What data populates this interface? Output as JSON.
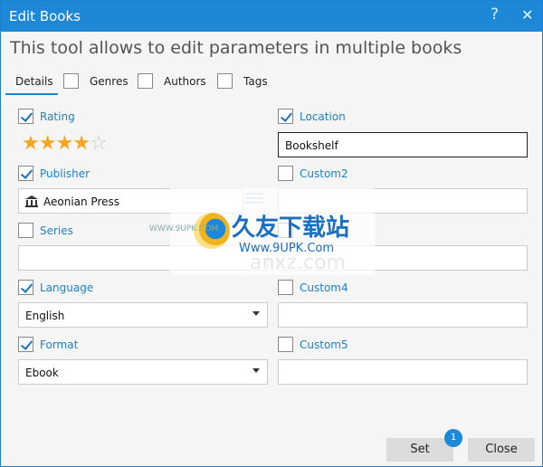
{
  "window": {
    "title": "Edit Books",
    "help_label": "?",
    "close_label": "✕"
  },
  "headline": "This tool allows to edit parameters in multiple books",
  "tabs": [
    {
      "label": "Details",
      "selected": true
    },
    {
      "label": "Genres"
    },
    {
      "label": "Authors"
    },
    {
      "label": "Tags"
    }
  ],
  "left": {
    "rating": {
      "label": "Rating",
      "checked": true,
      "stars_filled": 4,
      "stars_total": 5
    },
    "publisher": {
      "label": "Publisher",
      "checked": true,
      "value": "Aeonian Press"
    },
    "series": {
      "label": "Series",
      "checked": false,
      "value": ""
    },
    "language": {
      "label": "Language",
      "checked": true,
      "value": "English"
    },
    "format": {
      "label": "Format",
      "checked": true,
      "value": "Ebook"
    }
  },
  "right": {
    "location": {
      "label": "Location",
      "checked": true,
      "value": "Bookshelf"
    },
    "custom2": {
      "label": "Custom2",
      "checked": false,
      "value": ""
    },
    "custom3": {
      "label": "",
      "checked": false,
      "value": ""
    },
    "custom4": {
      "label": "Custom4",
      "checked": false,
      "value": ""
    },
    "custom5": {
      "label": "Custom5",
      "checked": false,
      "value": ""
    }
  },
  "buttons": {
    "set_label": "Set",
    "set_badge": "1",
    "close_label": "Close"
  },
  "watermark": {
    "title": "久友下载站",
    "url": "Www.9UPK.Com",
    "small": "WWW.9UPK.COM",
    "faint": "anxz.com"
  },
  "colors": {
    "accent": "#1e88d8",
    "star": "#f5a623"
  }
}
